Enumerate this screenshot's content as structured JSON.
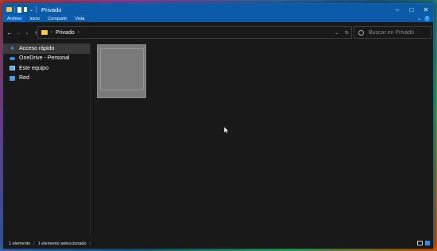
{
  "window": {
    "title": "Privado"
  },
  "ribbon": {
    "tabs": [
      "Archivo",
      "Inicio",
      "Compartir",
      "Vista"
    ]
  },
  "address": {
    "path": "Privado"
  },
  "search": {
    "placeholder": "Buscar en Privado"
  },
  "sidebar": {
    "items": [
      {
        "label": "Acceso rápido",
        "icon": "star-icon"
      },
      {
        "label": "OneDrive - Personal",
        "icon": "cloud-icon"
      },
      {
        "label": "Este equipo",
        "icon": "pc-icon"
      },
      {
        "label": "Red",
        "icon": "network-icon"
      }
    ]
  },
  "status": {
    "count": "1 elemento",
    "selected": "1 elemento seleccionado"
  },
  "colors": {
    "titlebar": "#0b5ba8",
    "background": "#191919",
    "accent": "#2d8cf0"
  }
}
